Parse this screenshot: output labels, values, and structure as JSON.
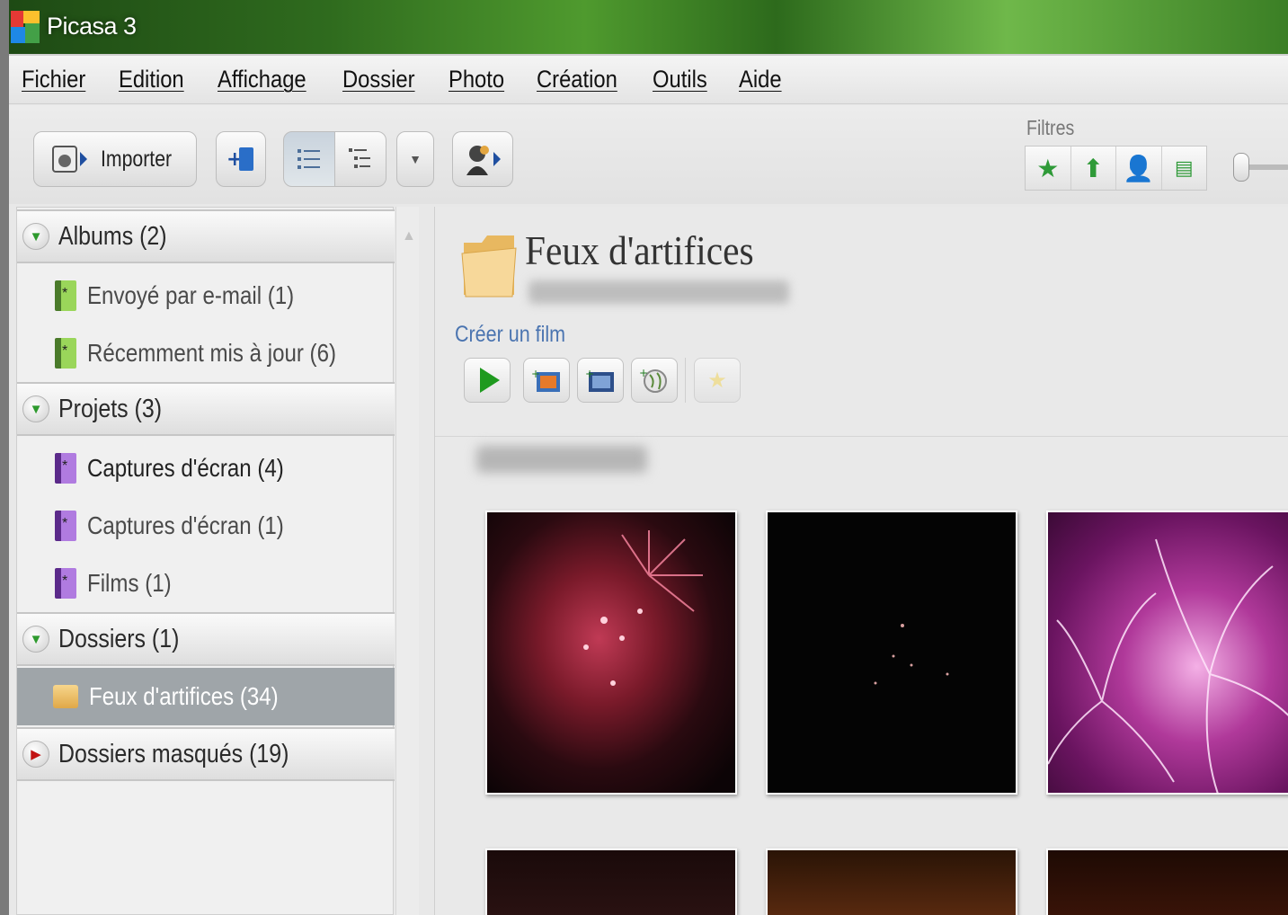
{
  "window": {
    "title": "Picasa 3"
  },
  "menu": [
    "Fichier",
    "Edition",
    "Affichage",
    "Dossier",
    "Photo",
    "Création",
    "Outils",
    "Aide"
  ],
  "toolbar": {
    "import_label": "Importer",
    "filters_label": "Filtres",
    "filters": [
      "star-icon",
      "upload-icon",
      "person-icon",
      "film-icon"
    ]
  },
  "sidebar": {
    "sections": [
      {
        "label": "Albums (2)",
        "expanded": true,
        "items": [
          {
            "label": "Envoyé par e-mail (1)",
            "icon": "album-green-icon"
          },
          {
            "label": "Récemment mis à jour (6)",
            "icon": "album-green-icon"
          }
        ]
      },
      {
        "label": "Projets (3)",
        "expanded": true,
        "items": [
          {
            "label": "Captures d'écran (4)",
            "icon": "album-purple-icon",
            "bold": true
          },
          {
            "label": "Captures d'écran (1)",
            "icon": "album-purple-icon"
          },
          {
            "label": "Films (1)",
            "icon": "album-purple-icon"
          }
        ]
      },
      {
        "label": "Dossiers (1)",
        "expanded": true,
        "items": [
          {
            "label": "Feux d'artifices (34)",
            "icon": "folder-icon",
            "selected": true
          }
        ]
      },
      {
        "label": "Dossiers masqués (19)",
        "expanded": false,
        "items": []
      }
    ]
  },
  "content": {
    "folder_title": "Feux d'artifices",
    "create_movie": "Créer un film"
  },
  "colors": {
    "accent": "#4a74b0",
    "selected": "#9fa5a9",
    "green": "#2f9a38"
  }
}
